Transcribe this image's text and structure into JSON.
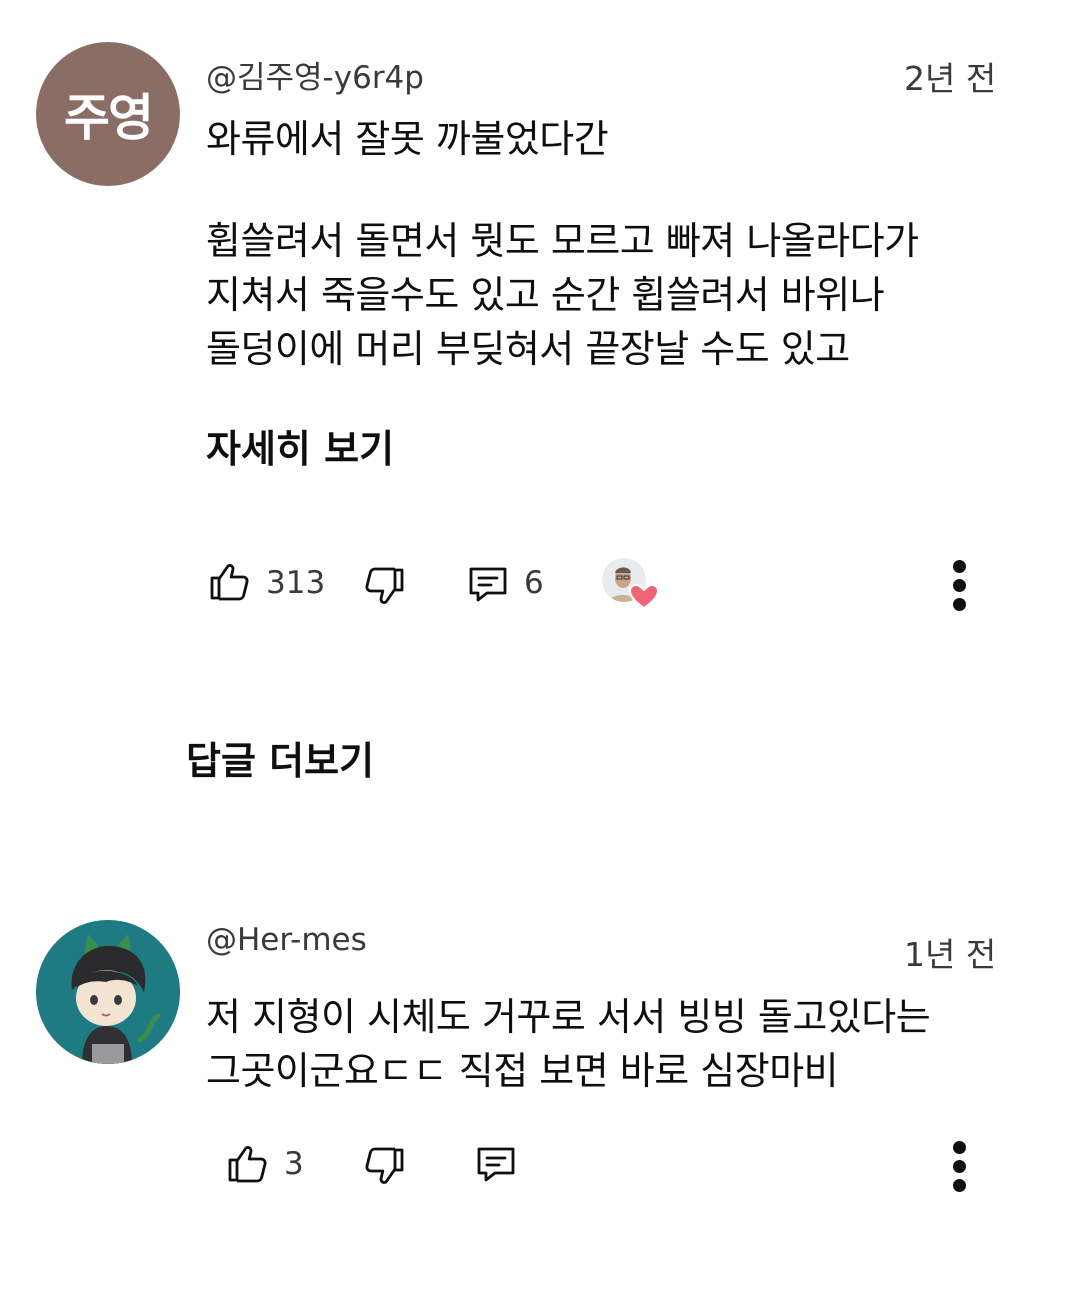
{
  "comments": [
    {
      "avatar_initials": "주영",
      "avatar_color": "#8a6e65",
      "handle": "@김주영-y6r4p",
      "time": "2년 전",
      "lines": [
        "와류에서 잘못 까불었다간",
        "",
        "휩쓸려서 돌면서 뭣도 모르고 빠져 나올라다가",
        "지쳐서 죽을수도 있고 순간 휩쓸려서 바위나",
        "돌덩이에 머리 부딪혀서 끝장날 수도 있고"
      ],
      "read_more": "자세히 보기",
      "like_count": "313",
      "reply_count": "6",
      "creator_heart": true,
      "more_replies": "답글 더보기"
    },
    {
      "avatar_style": "cartoon-boy-on-teal",
      "avatar_color": "#1f7b83",
      "handle": "@Her-mes",
      "time": "1년 전",
      "lines": [
        "저 지형이 시체도 거꾸로 서서 빙빙 돌고있다는",
        "그곳이군요ㄷㄷ 직접 보면 바로 심장마비"
      ],
      "like_count": "3"
    }
  ],
  "icons": {
    "like": "thumbs-up-icon",
    "dislike": "thumbs-down-icon",
    "reply": "comment-icon",
    "more": "more-vertical-icon",
    "heart": "heart-icon"
  },
  "colors": {
    "heart": "#f06478",
    "text": "#0f0f0f",
    "meta": "#3a3a3a"
  }
}
